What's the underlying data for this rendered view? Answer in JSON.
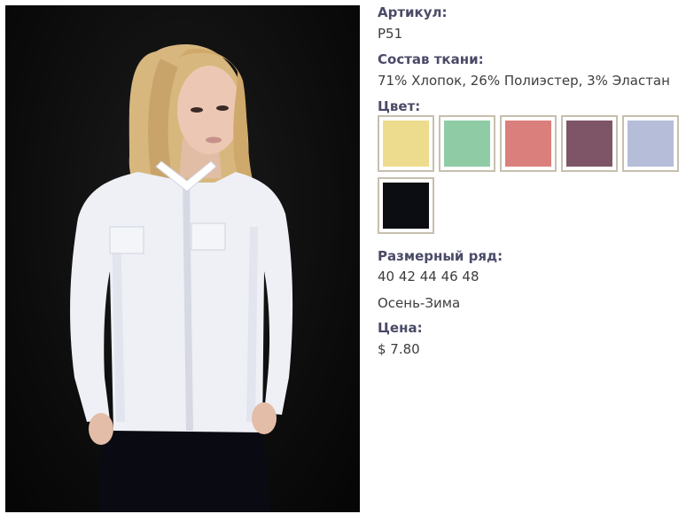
{
  "product": {
    "sku_label": "Артикул:",
    "sku_value": "P51",
    "fabric_label": "Состав ткани:",
    "fabric_value": "71% Хлопок, 26% Полиэстер, 3% Эластан",
    "color_label": "Цвет:",
    "colors": [
      {
        "name": "yellow-swatch",
        "hex": "#eedc8e"
      },
      {
        "name": "mint-swatch",
        "hex": "#8fcca6"
      },
      {
        "name": "pink-swatch",
        "hex": "#db7f7c"
      },
      {
        "name": "mauve-swatch",
        "hex": "#7e5566"
      },
      {
        "name": "lavender-swatch",
        "hex": "#b6bdd9"
      },
      {
        "name": "black-swatch",
        "hex": "#0c0d12"
      }
    ],
    "sizes_label": "Размерный ряд:",
    "sizes_value": "40 42 44 46 48",
    "season_value": "Осень-Зима",
    "price_label": "Цена:",
    "price_value": "$ 7.80"
  }
}
